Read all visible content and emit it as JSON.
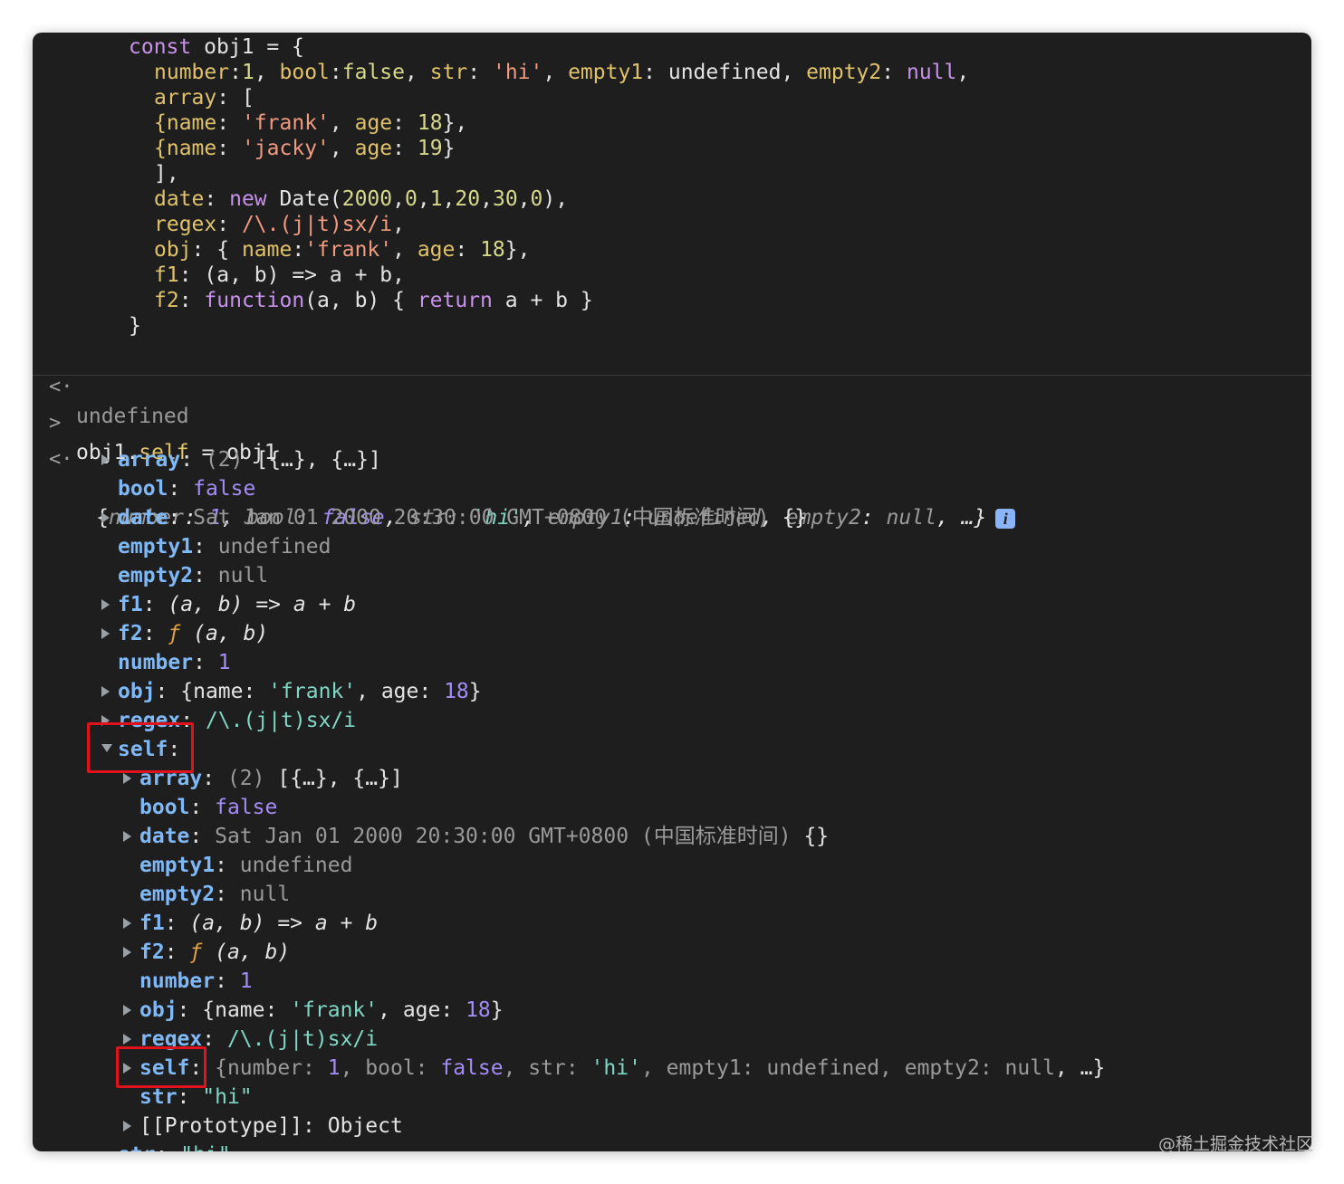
{
  "input_code": [
    [
      {
        "t": "const ",
        "c": "kw"
      },
      {
        "t": "obj1 = {",
        "c": "plain"
      }
    ],
    [
      {
        "t": "number",
        "c": "prop"
      },
      {
        "t": ":",
        "c": "plain"
      },
      {
        "t": "1",
        "c": "num"
      },
      {
        "t": ", ",
        "c": "plain"
      },
      {
        "t": "bool",
        "c": "prop"
      },
      {
        "t": ":",
        "c": "plain"
      },
      {
        "t": "false",
        "c": "num"
      },
      {
        "t": ", ",
        "c": "plain"
      },
      {
        "t": "str",
        "c": "prop"
      },
      {
        "t": ": ",
        "c": "plain"
      },
      {
        "t": "'hi'",
        "c": "str"
      },
      {
        "t": ", ",
        "c": "plain"
      },
      {
        "t": "empty1",
        "c": "prop"
      },
      {
        "t": ": undefined, ",
        "c": "plain"
      },
      {
        "t": "empty2",
        "c": "prop"
      },
      {
        "t": ": ",
        "c": "plain"
      },
      {
        "t": "null",
        "c": "kw"
      },
      {
        "t": ",",
        "c": "plain"
      }
    ],
    [
      {
        "t": "array",
        "c": "prop"
      },
      {
        "t": ": [",
        "c": "plain"
      }
    ],
    [
      {
        "t": "{name",
        "c": "prop"
      },
      {
        "t": ": ",
        "c": "plain"
      },
      {
        "t": "'frank'",
        "c": "str"
      },
      {
        "t": ", ",
        "c": "plain"
      },
      {
        "t": "age",
        "c": "prop"
      },
      {
        "t": ": ",
        "c": "plain"
      },
      {
        "t": "18",
        "c": "num"
      },
      {
        "t": "},",
        "c": "plain"
      }
    ],
    [
      {
        "t": "{name",
        "c": "prop"
      },
      {
        "t": ": ",
        "c": "plain"
      },
      {
        "t": "'jacky'",
        "c": "str"
      },
      {
        "t": ", ",
        "c": "plain"
      },
      {
        "t": "age",
        "c": "prop"
      },
      {
        "t": ": ",
        "c": "plain"
      },
      {
        "t": "19",
        "c": "num"
      },
      {
        "t": "}",
        "c": "plain"
      }
    ],
    [
      {
        "t": "],",
        "c": "plain"
      }
    ],
    [
      {
        "t": "date",
        "c": "prop"
      },
      {
        "t": ": ",
        "c": "plain"
      },
      {
        "t": "new ",
        "c": "kw"
      },
      {
        "t": "Date(",
        "c": "plain"
      },
      {
        "t": "2000",
        "c": "num"
      },
      {
        "t": ",",
        "c": "plain"
      },
      {
        "t": "0",
        "c": "num"
      },
      {
        "t": ",",
        "c": "plain"
      },
      {
        "t": "1",
        "c": "num"
      },
      {
        "t": ",",
        "c": "plain"
      },
      {
        "t": "20",
        "c": "num"
      },
      {
        "t": ",",
        "c": "plain"
      },
      {
        "t": "30",
        "c": "num"
      },
      {
        "t": ",",
        "c": "plain"
      },
      {
        "t": "0",
        "c": "num"
      },
      {
        "t": "),",
        "c": "plain"
      }
    ],
    [
      {
        "t": "regex",
        "c": "prop"
      },
      {
        "t": ": ",
        "c": "plain"
      },
      {
        "t": "/\\.(j|t)sx/i",
        "c": "str"
      },
      {
        "t": ",",
        "c": "plain"
      }
    ],
    [
      {
        "t": "obj",
        "c": "prop"
      },
      {
        "t": ": { ",
        "c": "plain"
      },
      {
        "t": "name",
        "c": "prop"
      },
      {
        "t": ":",
        "c": "plain"
      },
      {
        "t": "'frank'",
        "c": "str"
      },
      {
        "t": ", ",
        "c": "plain"
      },
      {
        "t": "age",
        "c": "prop"
      },
      {
        "t": ": ",
        "c": "plain"
      },
      {
        "t": "18",
        "c": "num"
      },
      {
        "t": "},",
        "c": "plain"
      }
    ],
    [
      {
        "t": "f1",
        "c": "prop"
      },
      {
        "t": ": (a, b) => a + b,",
        "c": "plain"
      }
    ],
    [
      {
        "t": "f2",
        "c": "prop"
      },
      {
        "t": ": ",
        "c": "plain"
      },
      {
        "t": "function",
        "c": "kw"
      },
      {
        "t": "(a, b) { ",
        "c": "plain"
      },
      {
        "t": "return",
        "c": "kw"
      },
      {
        "t": " a + b }",
        "c": "plain"
      }
    ],
    [
      {
        "t": "}",
        "c": "plain"
      }
    ]
  ],
  "result_1": "undefined",
  "prompt_input": "obj1.self = obj1",
  "prompt_input_parts": [
    {
      "t": "obj1.",
      "c": "plain"
    },
    {
      "t": "self",
      "c": "prop"
    },
    {
      "t": " = obj1",
      "c": "plain"
    }
  ],
  "summary": [
    {
      "t": "{",
      "c": "plain"
    },
    {
      "t": "number",
      "c": "dim italic"
    },
    {
      "t": ": ",
      "c": "plain italic"
    },
    {
      "t": "1",
      "c": "oval-num italic"
    },
    {
      "t": ", ",
      "c": "plain italic"
    },
    {
      "t": "bool",
      "c": "dim italic"
    },
    {
      "t": ": ",
      "c": "plain italic"
    },
    {
      "t": "false",
      "c": "oval-bool italic"
    },
    {
      "t": ", ",
      "c": "plain italic"
    },
    {
      "t": "str",
      "c": "dim italic"
    },
    {
      "t": ": ",
      "c": "plain italic"
    },
    {
      "t": "'hi'",
      "c": "oval-str italic"
    },
    {
      "t": ", ",
      "c": "plain italic"
    },
    {
      "t": "empty1",
      "c": "dim italic"
    },
    {
      "t": ": ",
      "c": "plain italic"
    },
    {
      "t": "undefined",
      "c": "oval-undef italic"
    },
    {
      "t": ", ",
      "c": "plain italic"
    },
    {
      "t": "empty2",
      "c": "dim italic"
    },
    {
      "t": ": ",
      "c": "plain italic"
    },
    {
      "t": "null",
      "c": "oval-undef italic"
    },
    {
      "t": ", …}",
      "c": "plain italic"
    }
  ],
  "tree": [
    {
      "depth": 0,
      "exp": "right",
      "key": "array",
      "val": [
        {
          "t": "(2) ",
          "c": "dim"
        },
        {
          "t": "[{…}, {…}]",
          "c": "plain"
        }
      ]
    },
    {
      "depth": 0,
      "exp": "none",
      "key": "bool",
      "val": [
        {
          "t": "false",
          "c": "oval-bool"
        }
      ]
    },
    {
      "depth": 0,
      "exp": "right",
      "key": "date",
      "val": [
        {
          "t": "Sat Jan 01 2000 20:30:00 GMT+0800 (中国标准时间) ",
          "c": "dim"
        },
        {
          "t": "{}",
          "c": "plain"
        }
      ]
    },
    {
      "depth": 0,
      "exp": "none",
      "key": "empty1",
      "val": [
        {
          "t": "undefined",
          "c": "oval-undef"
        }
      ]
    },
    {
      "depth": 0,
      "exp": "none",
      "key": "empty2",
      "val": [
        {
          "t": "null",
          "c": "oval-undef"
        }
      ]
    },
    {
      "depth": 0,
      "exp": "right",
      "key": "f1",
      "val": [
        {
          "t": "(a, b) => a + b",
          "c": "plain italic"
        }
      ]
    },
    {
      "depth": 0,
      "exp": "right",
      "key": "f2",
      "val": [
        {
          "t": "ƒ ",
          "c": "oval-fnf"
        },
        {
          "t": "(a, b)",
          "c": "plain italic"
        }
      ]
    },
    {
      "depth": 0,
      "exp": "none",
      "key": "number",
      "val": [
        {
          "t": "1",
          "c": "oval-num"
        }
      ]
    },
    {
      "depth": 0,
      "exp": "right",
      "key": "obj",
      "val": [
        {
          "t": "{name: ",
          "c": "plain"
        },
        {
          "t": "'frank'",
          "c": "oval-str"
        },
        {
          "t": ", age: ",
          "c": "plain"
        },
        {
          "t": "18",
          "c": "oval-num"
        },
        {
          "t": "}",
          "c": "plain"
        }
      ]
    },
    {
      "depth": 0,
      "exp": "right",
      "key": "regex",
      "val": [
        {
          "t": "/\\.(j|t)sx/i",
          "c": "oval-str"
        }
      ]
    },
    {
      "depth": 0,
      "exp": "down",
      "key": "self",
      "val": []
    },
    {
      "depth": 1,
      "exp": "right",
      "key": "array",
      "val": [
        {
          "t": "(2) ",
          "c": "dim"
        },
        {
          "t": "[{…}, {…}]",
          "c": "plain"
        }
      ]
    },
    {
      "depth": 1,
      "exp": "none",
      "key": "bool",
      "val": [
        {
          "t": "false",
          "c": "oval-bool"
        }
      ]
    },
    {
      "depth": 1,
      "exp": "right",
      "key": "date",
      "val": [
        {
          "t": "Sat Jan 01 2000 20:30:00 GMT+0800 (中国标准时间) ",
          "c": "dim"
        },
        {
          "t": "{}",
          "c": "plain"
        }
      ]
    },
    {
      "depth": 1,
      "exp": "none",
      "key": "empty1",
      "val": [
        {
          "t": "undefined",
          "c": "oval-undef"
        }
      ]
    },
    {
      "depth": 1,
      "exp": "none",
      "key": "empty2",
      "val": [
        {
          "t": "null",
          "c": "oval-undef"
        }
      ]
    },
    {
      "depth": 1,
      "exp": "right",
      "key": "f1",
      "val": [
        {
          "t": "(a, b) => a + b",
          "c": "plain italic"
        }
      ]
    },
    {
      "depth": 1,
      "exp": "right",
      "key": "f2",
      "val": [
        {
          "t": "ƒ ",
          "c": "oval-fnf"
        },
        {
          "t": "(a, b)",
          "c": "plain italic"
        }
      ]
    },
    {
      "depth": 1,
      "exp": "none",
      "key": "number",
      "val": [
        {
          "t": "1",
          "c": "oval-num"
        }
      ]
    },
    {
      "depth": 1,
      "exp": "right",
      "key": "obj",
      "val": [
        {
          "t": "{name: ",
          "c": "plain"
        },
        {
          "t": "'frank'",
          "c": "oval-str"
        },
        {
          "t": ", age: ",
          "c": "plain"
        },
        {
          "t": "18",
          "c": "oval-num"
        },
        {
          "t": "}",
          "c": "plain"
        }
      ]
    },
    {
      "depth": 1,
      "exp": "right",
      "key": "regex",
      "val": [
        {
          "t": "/\\.(j|t)sx/i",
          "c": "oval-str"
        }
      ]
    },
    {
      "depth": 1,
      "exp": "right",
      "key": "self",
      "val": [
        {
          "t": "{number: ",
          "c": "dim"
        },
        {
          "t": "1",
          "c": "oval-num"
        },
        {
          "t": ", bool: ",
          "c": "dim"
        },
        {
          "t": "false",
          "c": "oval-bool"
        },
        {
          "t": ", str: ",
          "c": "dim"
        },
        {
          "t": "'hi'",
          "c": "oval-str"
        },
        {
          "t": ", empty1: ",
          "c": "dim"
        },
        {
          "t": "undefined",
          "c": "oval-undef"
        },
        {
          "t": ", empty2: ",
          "c": "dim"
        },
        {
          "t": "null",
          "c": "oval-undef"
        },
        {
          "t": ", …}",
          "c": "plain"
        }
      ]
    },
    {
      "depth": 1,
      "exp": "none",
      "key": "str",
      "val": [
        {
          "t": "\"hi\"",
          "c": "oval-str"
        }
      ]
    },
    {
      "depth": 1,
      "exp": "right",
      "key": "[[Prototype]]",
      "keyClass": "plain",
      "val": [
        {
          "t": "Object",
          "c": "plain"
        }
      ]
    },
    {
      "depth": 0,
      "exp": "none",
      "key": "str",
      "val": [
        {
          "t": "\"hi\"",
          "c": "oval-str"
        }
      ]
    }
  ],
  "watermark": "@稀土掘金技术社区",
  "colors": {
    "background": "#1e1e1e",
    "highlight": "#e0121b",
    "key": "#7fb8f7"
  }
}
